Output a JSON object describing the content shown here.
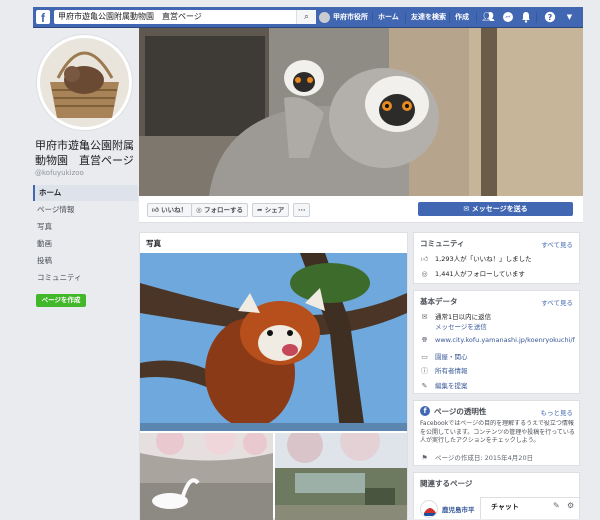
{
  "topbar": {
    "search_value": "甲府市遊亀公園附属動物園　直営ページ",
    "user_name": "甲府市役所",
    "home": "ホーム",
    "find_friends": "友達を検索",
    "create": "作成"
  },
  "page": {
    "name": "甲府市遊亀公園附属動物園　直営ページ",
    "handle": "@kofuyukizoo"
  },
  "left_nav": [
    "ホーム",
    "ページ情報",
    "写真",
    "動画",
    "投稿",
    "コミュニティ"
  ],
  "create_page_button": "ページを作成",
  "actions": {
    "like": "いいね！",
    "follow": "フォローする",
    "share": "シェア",
    "more": "···",
    "message": "メッセージを送る"
  },
  "photos": {
    "title": "写真"
  },
  "community": {
    "title": "コミュニティ",
    "see_all": "すべて見る",
    "likes": "1,293人が「いいね！」しました",
    "follows": "1,441人がフォローしています"
  },
  "about": {
    "title": "基本データ",
    "see_all": "すべて見る",
    "response": "通常1日以内に返信",
    "send_message": "メッセージを送信",
    "website": "www.city.kofu.yamanashi.jp/koenryokuchi/facebook",
    "category": "園屋・関心",
    "owner": "所有者情報",
    "suggest_edit": "編集を提案"
  },
  "transparency": {
    "title": "ページの透明性",
    "more": "もっと見る",
    "text": "Facebookではページの目的を理解するうえで役立つ情報を公開しています。コンテンツの管理や投稿を行っている人が実行したアクションをチェックしよう。",
    "created": "ページの作成日: 2015年4月20日"
  },
  "related": {
    "title": "関連するページ",
    "item": "鹿児島市平"
  },
  "chat": "チャット",
  "colors": {
    "brand": "#4267b2",
    "green": "#42b72a"
  }
}
